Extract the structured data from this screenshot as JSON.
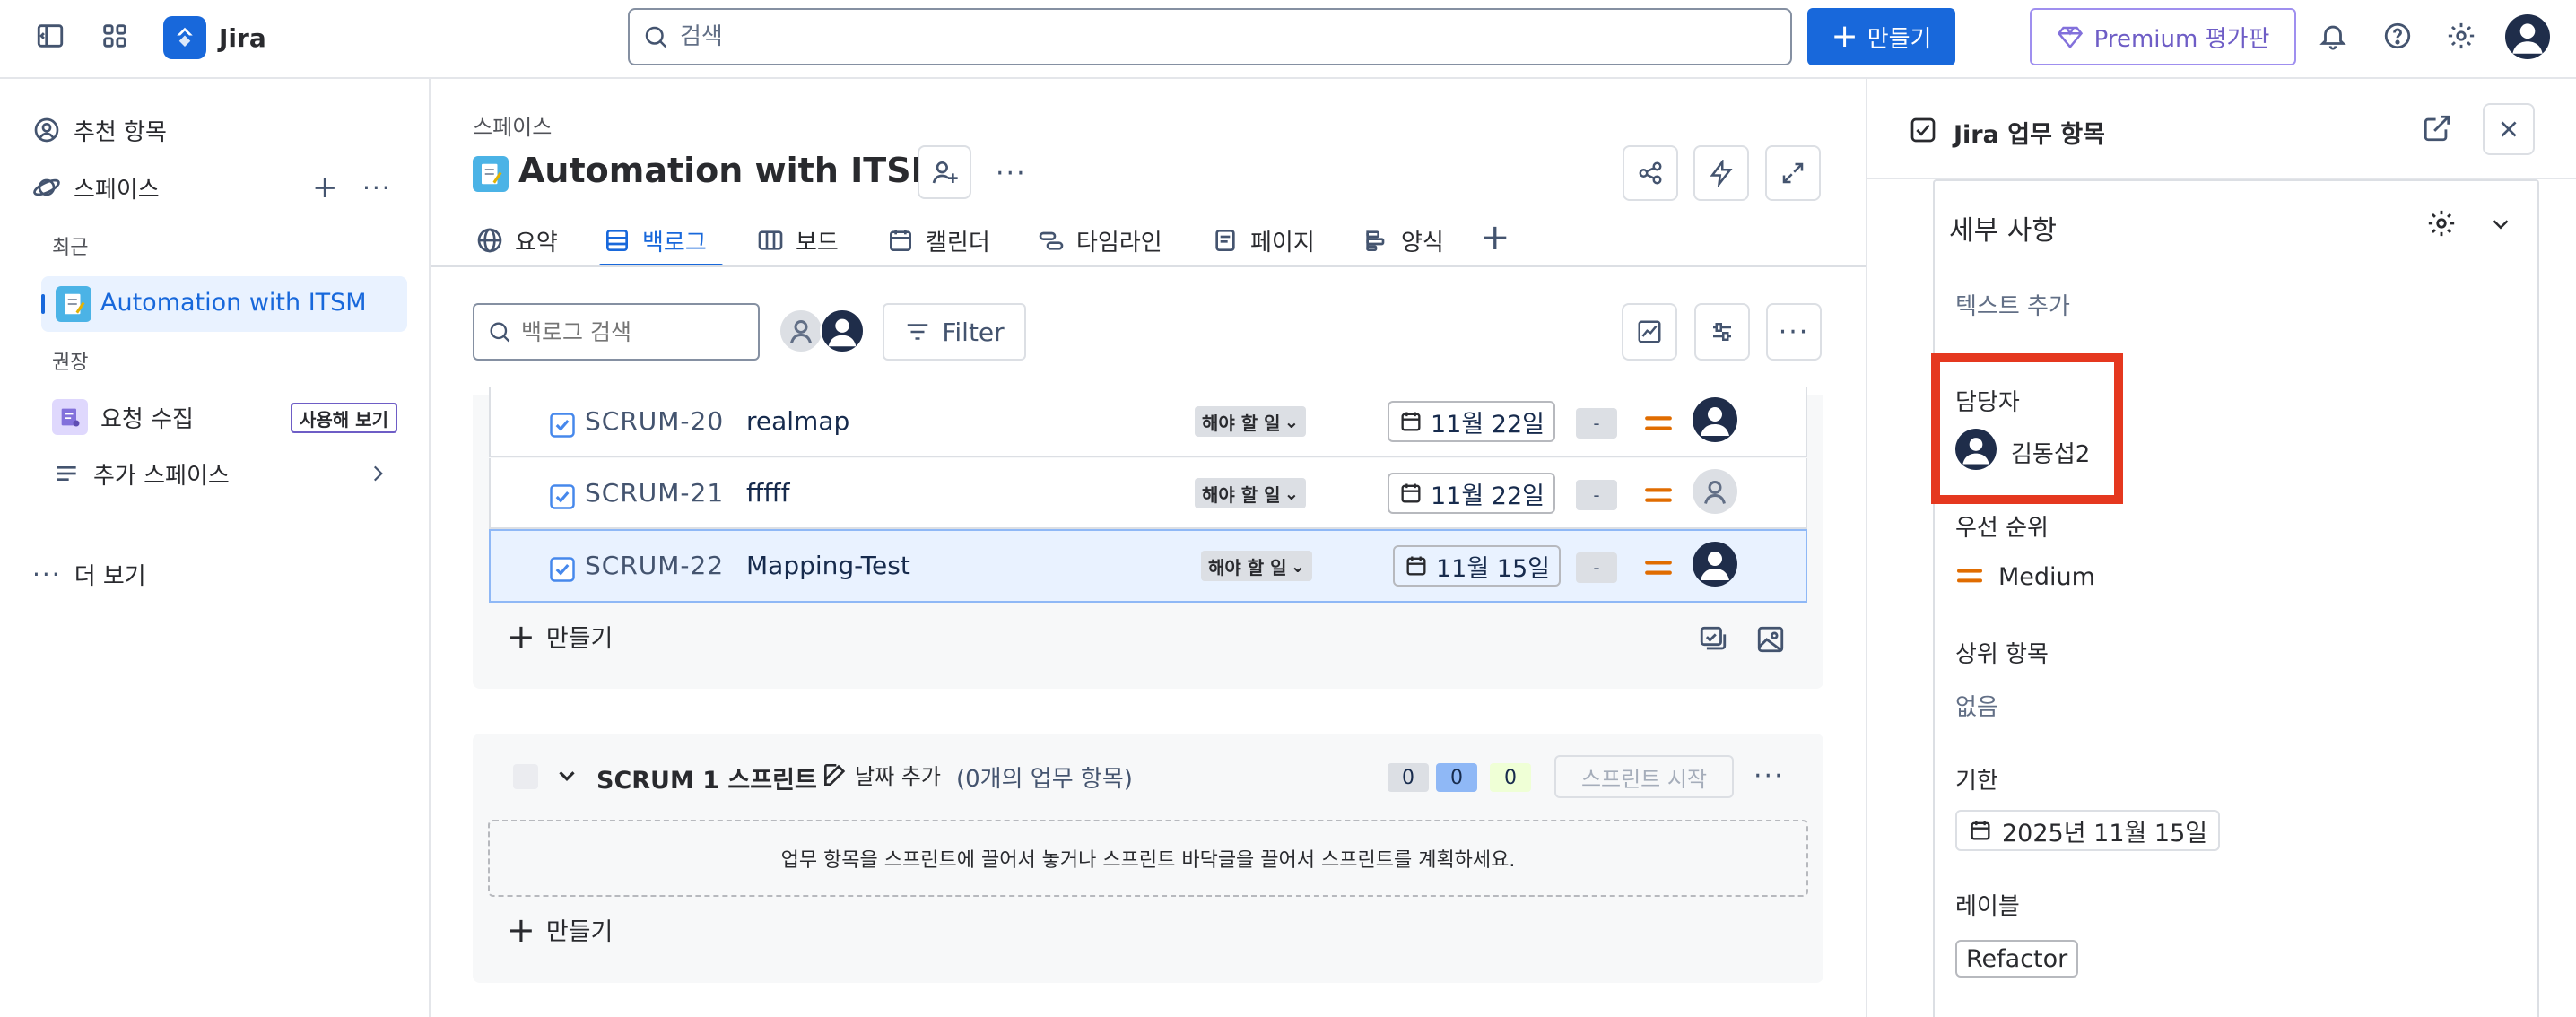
{
  "topnav": {
    "app_name": "Jira",
    "search_placeholder": "검색",
    "create_label": "만들기",
    "premium_label": "Premium 평가판"
  },
  "sidebar": {
    "recommended": "추천 항목",
    "spaces": "스페이스",
    "recent_header": "최근",
    "recent_project": "Automation with ITSM",
    "recommended_header": "권장",
    "request_intake": "요청 수집",
    "try_badge": "사용해 보기",
    "more_spaces": "추가 스페이스",
    "more": "더 보기"
  },
  "main": {
    "breadcrumb": "스페이스",
    "title": "Automation with ITSM",
    "tabs": [
      {
        "label": "요약"
      },
      {
        "label": "백로그"
      },
      {
        "label": "보드"
      },
      {
        "label": "캘린더"
      },
      {
        "label": "타임라인"
      },
      {
        "label": "페이지"
      },
      {
        "label": "양식"
      }
    ],
    "backlog_search_placeholder": "백로그 검색",
    "filter_label": "Filter",
    "rows": [
      {
        "key": "SCRUM-20",
        "summary": "realmap",
        "status": "해야 할 일",
        "date": "11월 22일",
        "estimate": "-"
      },
      {
        "key": "SCRUM-21",
        "summary": "fffff",
        "status": "해야 할 일",
        "date": "11월 22일",
        "estimate": "-"
      },
      {
        "key": "SCRUM-22",
        "summary": "Mapping-Test",
        "status": "해야 할 일",
        "date": "11월 15일",
        "estimate": "-"
      }
    ],
    "create_label": "만들기",
    "sprint": {
      "name": "SCRUM 1 스프린트",
      "add_date": "날짜 추가",
      "count": "(0개의 업무 항목)",
      "counts": [
        "0",
        "0",
        "0"
      ],
      "start_label": "스프린트 시작",
      "empty_text": "업무 항목을 스프린트에 끌어서 놓거나 스프린트 바닥글을 끌어서 스프린트를 계획하세요.",
      "create_label": "만들기"
    }
  },
  "panel": {
    "title": "Jira 업무 항목",
    "details_header": "세부 사항",
    "add_text": "텍스트 추가",
    "assignee_label": "담당자",
    "assignee_name": "김동섭2",
    "priority_label": "우선 순위",
    "priority_value": "Medium",
    "parent_label": "상위 항목",
    "parent_value": "없음",
    "due_label": "기한",
    "due_value": "2025년 11월 15일",
    "labels_label": "레이블",
    "label_value": "Refactor"
  },
  "colors": {
    "brand_blue": "#1868db",
    "premium_purple": "#6e5dc6",
    "priority_orange": "#e06c00",
    "highlight_red": "#e5381f"
  }
}
